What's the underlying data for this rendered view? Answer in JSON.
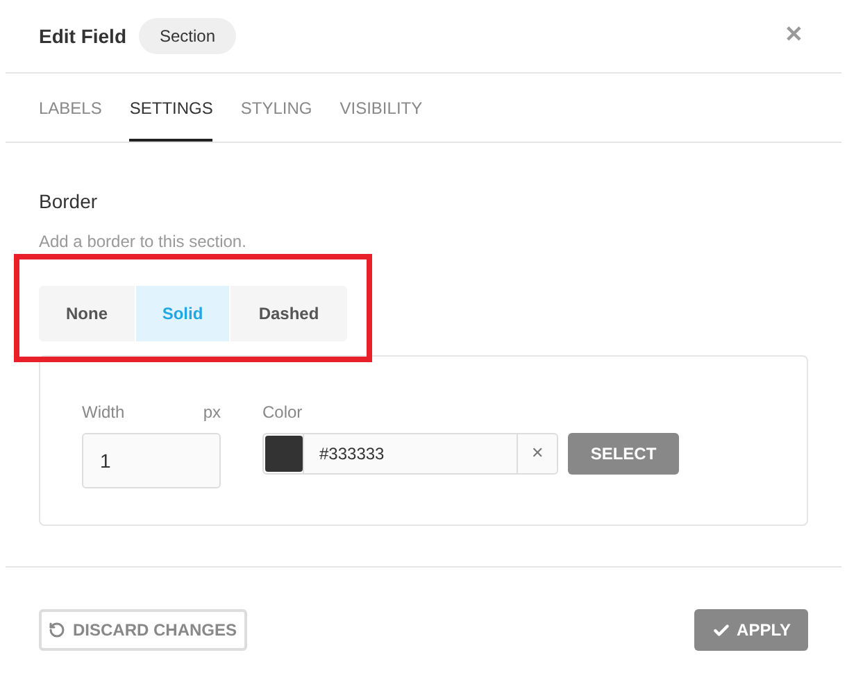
{
  "header": {
    "title": "Edit Field",
    "badge": "Section",
    "close": "✕"
  },
  "tabs": [
    {
      "label": "LABELS",
      "selected": false
    },
    {
      "label": "SETTINGS",
      "selected": true
    },
    {
      "label": "STYLING",
      "selected": false
    },
    {
      "label": "VISIBILITY",
      "selected": false
    }
  ],
  "border": {
    "title": "Border",
    "description": "Add a border to this section.",
    "options": [
      {
        "label": "None",
        "selected": false
      },
      {
        "label": "Solid",
        "selected": true
      },
      {
        "label": "Dashed",
        "selected": false
      }
    ],
    "width": {
      "label": "Width",
      "unit": "px",
      "value": "1"
    },
    "color": {
      "label": "Color",
      "value": "#333333",
      "clear": "✕",
      "select": "SELECT"
    }
  },
  "footer": {
    "discard": "DISCARD CHANGES",
    "apply": "APPLY"
  }
}
